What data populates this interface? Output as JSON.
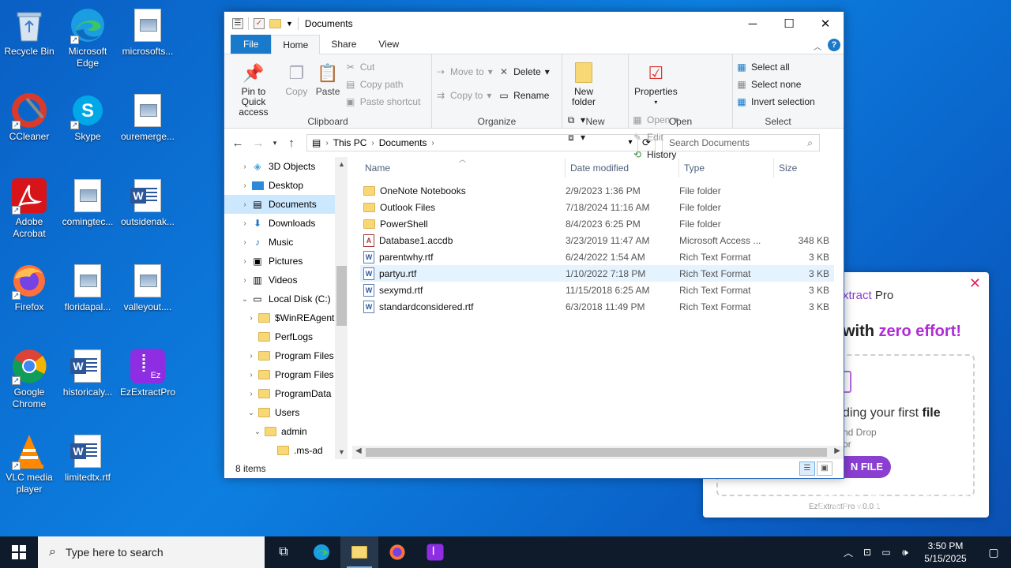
{
  "desktop": {
    "icons": [
      {
        "label": "Recycle Bin"
      },
      {
        "label": "Microsoft Edge"
      },
      {
        "label": "microsofts..."
      },
      {
        "label": "CCleaner"
      },
      {
        "label": "Skype"
      },
      {
        "label": "ouremerge..."
      },
      {
        "label": "Adobe Acrobat"
      },
      {
        "label": "comingtec..."
      },
      {
        "label": "outsidenak..."
      },
      {
        "label": "Firefox"
      },
      {
        "label": "floridapal..."
      },
      {
        "label": "valleyout...."
      },
      {
        "label": "Google Chrome"
      },
      {
        "label": "historicaly..."
      },
      {
        "label": "EzExtractPro"
      },
      {
        "label": "VLC media player"
      },
      {
        "label": "limitedtx.rtf"
      }
    ]
  },
  "window": {
    "title": "Documents",
    "tabs": {
      "file": "File",
      "home": "Home",
      "share": "Share",
      "view": "View"
    },
    "ribbon": {
      "clipboard": {
        "name": "Clipboard",
        "pin": "Pin to Quick access",
        "copy": "Copy",
        "paste": "Paste",
        "cut": "Cut",
        "copy_path": "Copy path",
        "paste_shortcut": "Paste shortcut"
      },
      "organize": {
        "name": "Organize",
        "move_to": "Move to",
        "copy_to": "Copy to",
        "delete": "Delete",
        "rename": "Rename"
      },
      "new": {
        "name": "New",
        "new_folder": "New folder"
      },
      "open": {
        "name": "Open",
        "properties": "Properties",
        "open": "Open",
        "edit": "Edit",
        "history": "History"
      },
      "select": {
        "name": "Select",
        "select_all": "Select all",
        "select_none": "Select none",
        "invert": "Invert selection"
      }
    },
    "address": {
      "this_pc": "This PC",
      "current": "Documents"
    },
    "search_placeholder": "Search Documents",
    "nav": [
      {
        "label": "3D Objects"
      },
      {
        "label": "Desktop"
      },
      {
        "label": "Documents"
      },
      {
        "label": "Downloads"
      },
      {
        "label": "Music"
      },
      {
        "label": "Pictures"
      },
      {
        "label": "Videos"
      },
      {
        "label": "Local Disk (C:)"
      },
      {
        "label": "$WinREAgent"
      },
      {
        "label": "PerfLogs"
      },
      {
        "label": "Program Files"
      },
      {
        "label": "Program Files"
      },
      {
        "label": "ProgramData"
      },
      {
        "label": "Users"
      },
      {
        "label": "admin"
      },
      {
        "label": ".ms-ad"
      }
    ],
    "columns": {
      "name": "Name",
      "date": "Date modified",
      "type": "Type",
      "size": "Size"
    },
    "files": [
      {
        "name": "OneNote Notebooks",
        "date": "2/9/2023 1:36 PM",
        "type": "File folder",
        "size": ""
      },
      {
        "name": "Outlook Files",
        "date": "7/18/2024 11:16 AM",
        "type": "File folder",
        "size": ""
      },
      {
        "name": "PowerShell",
        "date": "8/4/2023 6:25 PM",
        "type": "File folder",
        "size": ""
      },
      {
        "name": "Database1.accdb",
        "date": "3/23/2019 11:47 AM",
        "type": "Microsoft Access ...",
        "size": "348 KB"
      },
      {
        "name": "parentwhy.rtf",
        "date": "6/24/2022 1:54 AM",
        "type": "Rich Text Format",
        "size": "3 KB"
      },
      {
        "name": "partyu.rtf",
        "date": "1/10/2022 7:18 PM",
        "type": "Rich Text Format",
        "size": "3 KB"
      },
      {
        "name": "sexymd.rtf",
        "date": "11/15/2018 6:25 AM",
        "type": "Rich Text Format",
        "size": "3 KB"
      },
      {
        "name": "standardconsidered.rtf",
        "date": "6/3/2018 11:49 PM",
        "type": "Rich Text Format",
        "size": "3 KB"
      }
    ],
    "status": "8 items"
  },
  "popup": {
    "title_prefix": "xtract",
    "title_suffix": " Pro",
    "headline_a": "with ",
    "headline_b": "zero effort!",
    "line1_a": "ding your first ",
    "line1_b": "file",
    "line2": "nd Drop",
    "line3": "or",
    "button": "N FILE",
    "version": "EzExtractPro v.0.0.1"
  },
  "watermark": "ANY RUN",
  "taskbar": {
    "search_placeholder": "Type here to search",
    "time": "3:50 PM",
    "date": "5/15/2025"
  }
}
